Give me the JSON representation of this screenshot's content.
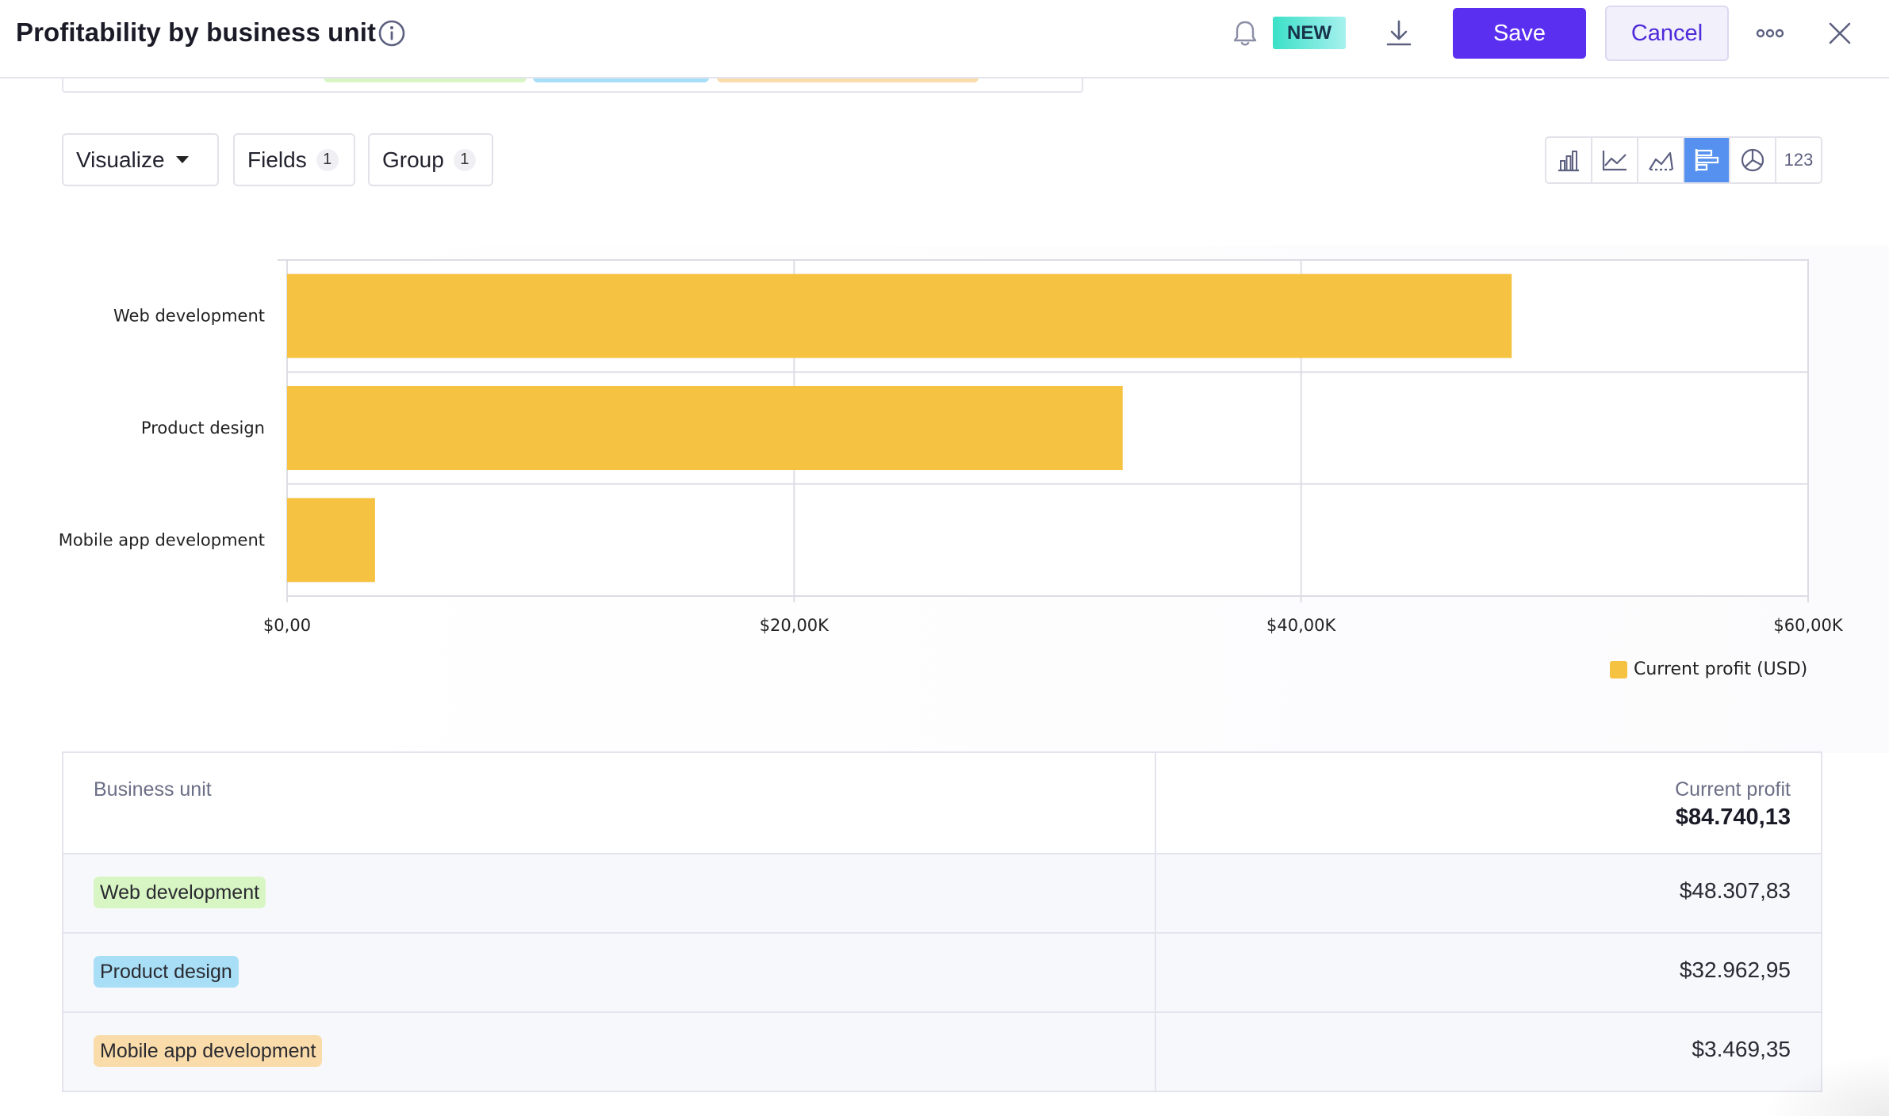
{
  "header": {
    "title": "Profitability by business unit",
    "new_badge": "NEW",
    "save_label": "Save",
    "cancel_label": "Cancel"
  },
  "toolbar": {
    "visualize_label": "Visualize",
    "fields_label": "Fields",
    "fields_count": "1",
    "group_label": "Group",
    "group_count": "1",
    "chart_types": [
      "bar-chart-icon",
      "line-chart-icon",
      "area-chart-icon",
      "horizontal-bar-chart-icon",
      "pie-chart-icon",
      "number"
    ],
    "number_label": "123",
    "active_chart_type": "horizontal-bar-chart-icon"
  },
  "colors": {
    "accent": "#5a2ff0",
    "bar": "#f5c242",
    "active_chart_type": "#5691f0"
  },
  "chart_data": {
    "type": "bar",
    "orientation": "horizontal",
    "categories": [
      "Web development",
      "Product design",
      "Mobile app development"
    ],
    "series": [
      {
        "name": "Current profit (USD)",
        "values": [
          48307.83,
          32962.95,
          3469.35
        ]
      }
    ],
    "xlim": [
      0,
      60000
    ],
    "x_ticks": [
      0,
      20000,
      40000,
      60000
    ],
    "x_tick_labels": [
      "$0,00",
      "$20,00K",
      "$40,00K",
      "$60,00K"
    ],
    "grid": true,
    "legend_position": "bottom-right"
  },
  "table": {
    "columns": [
      "Business unit",
      "Current profit"
    ],
    "total": "$84.740,13",
    "rows": [
      {
        "unit": "Web development",
        "profit": "$48.307,83",
        "tag_color": "#d8f5c4"
      },
      {
        "unit": "Product design",
        "profit": "$32.962,95",
        "tag_color": "#a8dff7"
      },
      {
        "unit": "Mobile app development",
        "profit": "$3.469,35",
        "tag_color": "#fadcaa"
      }
    ]
  }
}
